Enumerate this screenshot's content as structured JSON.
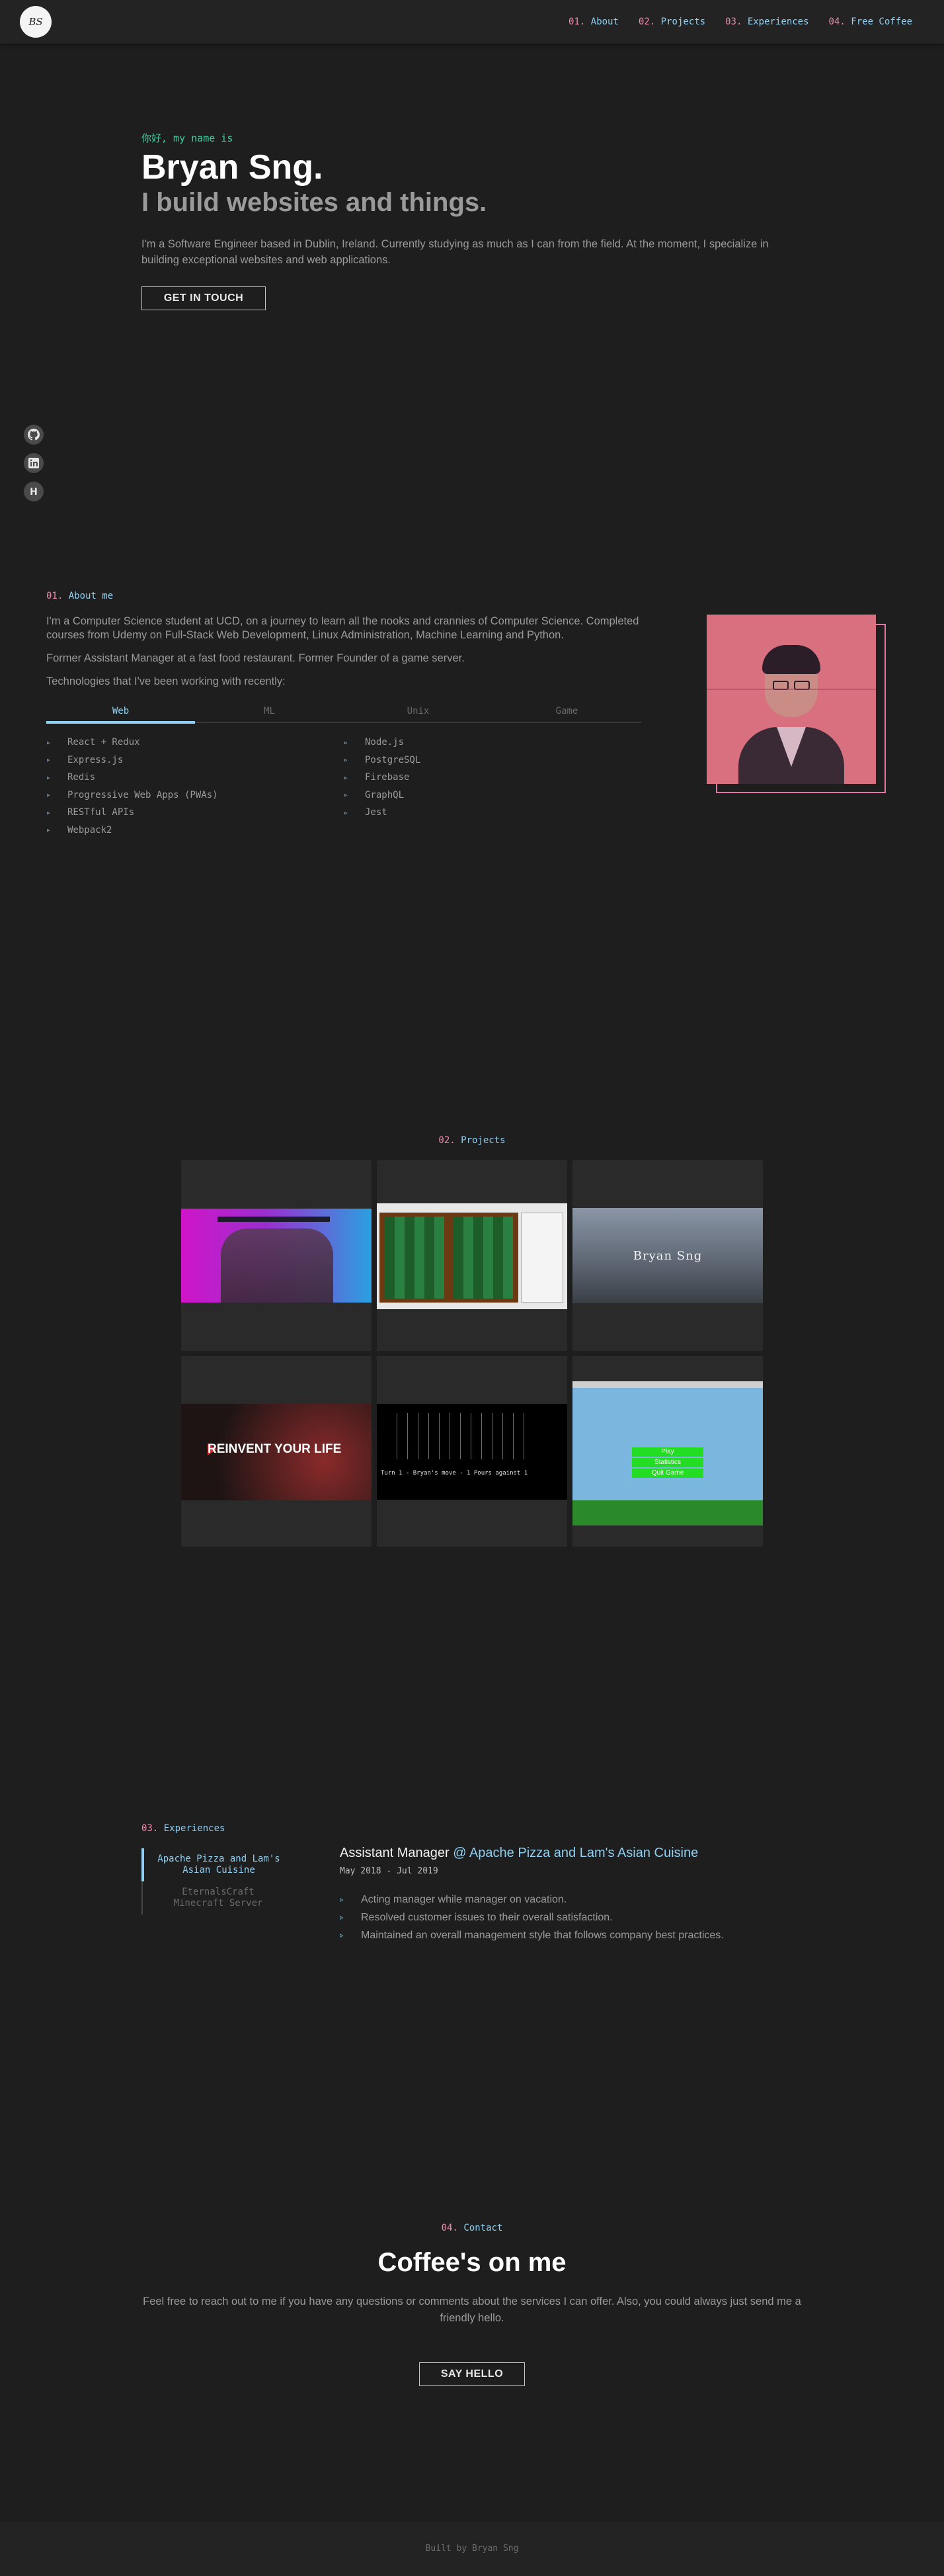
{
  "header": {
    "logo_text": "BS",
    "nav": [
      {
        "num": "01.",
        "label": "About"
      },
      {
        "num": "02.",
        "label": "Projects"
      },
      {
        "num": "03.",
        "label": "Experiences"
      },
      {
        "num": "04.",
        "label": "Free Coffee"
      }
    ]
  },
  "socials": [
    "github-icon",
    "linkedin-icon",
    "hashnode-icon"
  ],
  "hero": {
    "greeting": "你好, my name is",
    "name": "Bryan Sng.",
    "tagline": "I build websites and things.",
    "intro": "I'm a Software Engineer based in Dublin, Ireland. Currently studying as much as I can from the field. At the moment, I specialize in building exceptional websites and web applications.",
    "cta": "GET IN TOUCH"
  },
  "about": {
    "num": "01.",
    "heading": "About me",
    "p1": "I'm a Computer Science student at UCD, on a journey to learn all the nooks and crannies of Computer Science. Completed courses from Udemy on Full-Stack Web Development, Linux Administration, Machine Learning and Python.",
    "p2": "Former Assistant Manager at a fast food restaurant. Former Founder of a game server.",
    "p3": "Technologies that I've been working with recently:",
    "tabs": [
      "Web",
      "ML",
      "Unix",
      "Game"
    ],
    "tech_left": [
      "React + Redux",
      "Express.js",
      "Redis",
      "Progressive Web Apps (PWAs)",
      "RESTful APIs",
      "Webpack2"
    ],
    "tech_right": [
      "Node.js",
      "PostgreSQL",
      "Firebase",
      "GraphQL",
      "Jest"
    ]
  },
  "projects": {
    "num": "02.",
    "heading": "Projects",
    "thumb_texts": {
      "p3": "Bryan Sng",
      "p4": "REINVENT YOUR LIFE",
      "p5": "Turn 1 - Bryan's move - 1 Pours against 1",
      "p6": [
        "Play",
        "Statistics",
        "Quit Game"
      ]
    }
  },
  "experiences": {
    "num": "03.",
    "heading": "Experiences",
    "tabs": [
      "Apache Pizza and Lam's Asian Cuisine",
      "EternalsCraft Minecraft Server"
    ],
    "job": {
      "title": "Assistant Manager",
      "at": "@ Apache Pizza and Lam's Asian Cuisine",
      "date": "May 2018 - Jul 2019",
      "points": [
        "Acting manager while manager on vacation.",
        "Resolved customer issues to their overall satisfaction.",
        "Maintained an overall management style that follows company best practices."
      ]
    }
  },
  "contact": {
    "num": "04.",
    "heading": "Contact",
    "title": "Coffee's on me",
    "text": "Feel free to reach out to me if you have any questions or comments about the services I can offer. Also, you could always just send me a friendly hello.",
    "cta": "SAY HELLO"
  },
  "footer": {
    "text": "Built by Bryan Sng"
  }
}
